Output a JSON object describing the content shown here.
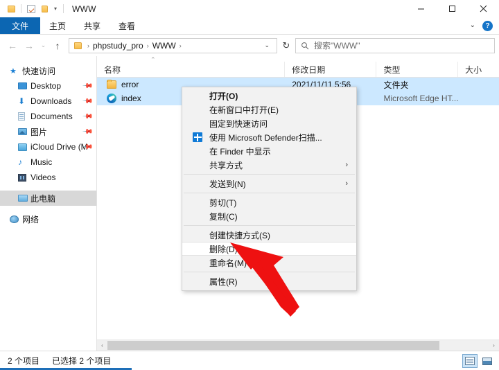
{
  "window": {
    "title": "WWW",
    "quick_access_icons": [
      "folder-icon",
      "properties-icon",
      "new-folder-icon"
    ],
    "controls": {
      "minimize": "minimize-icon",
      "maximize": "maximize-icon",
      "close": "close-icon"
    }
  },
  "ribbon": {
    "tabs": [
      {
        "label": "文件",
        "active": true
      },
      {
        "label": "主页",
        "active": false
      },
      {
        "label": "共享",
        "active": false
      },
      {
        "label": "查看",
        "active": false
      }
    ],
    "expand_label": "⌄",
    "help_label": "?"
  },
  "address": {
    "back": "←",
    "forward": "→",
    "recent": "⌄",
    "up": "↑",
    "crumbs": [
      "phpstudy_pro",
      "WWW"
    ],
    "separator": "›",
    "dropdown": "⌄",
    "refresh": "↻"
  },
  "search": {
    "placeholder": "搜索\"WWW\"",
    "icon": "search-icon"
  },
  "sidebar": {
    "items": [
      {
        "label": "快速访问",
        "icon": "star-icon",
        "pinned": false,
        "indent": false,
        "selected": false
      },
      {
        "label": "Desktop",
        "icon": "desktop-icon",
        "pinned": true,
        "indent": true,
        "selected": false
      },
      {
        "label": "Downloads",
        "icon": "download-icon",
        "pinned": true,
        "indent": true,
        "selected": false
      },
      {
        "label": "Documents",
        "icon": "document-icon",
        "pinned": true,
        "indent": true,
        "selected": false
      },
      {
        "label": "图片",
        "icon": "pictures-icon",
        "pinned": true,
        "indent": true,
        "selected": false
      },
      {
        "label": "iCloud Drive (M",
        "icon": "cloud-drive-icon",
        "pinned": true,
        "indent": true,
        "selected": false
      },
      {
        "label": "Music",
        "icon": "music-icon",
        "pinned": false,
        "indent": true,
        "selected": false
      },
      {
        "label": "Videos",
        "icon": "video-icon",
        "pinned": false,
        "indent": true,
        "selected": false
      },
      {
        "label": "此电脑",
        "icon": "this-pc-icon",
        "pinned": false,
        "indent": true,
        "selected": true
      },
      {
        "label": "网络",
        "icon": "network-icon",
        "pinned": false,
        "indent": false,
        "selected": false
      }
    ],
    "pin_glyph": "📌"
  },
  "filelist": {
    "sort_caret": "⌃",
    "columns": [
      {
        "key": "name",
        "label": "名称"
      },
      {
        "key": "date",
        "label": "修改日期"
      },
      {
        "key": "type",
        "label": "类型"
      },
      {
        "key": "size",
        "label": "大小"
      }
    ],
    "rows": [
      {
        "name": "error",
        "date": "2021/11/11 5:56",
        "type": "文件夹",
        "size": "",
        "icon": "folder-icon",
        "selected": true
      },
      {
        "name": "index",
        "date": "",
        "type": "Microsoft Edge HT...",
        "size": "",
        "icon": "edge-icon",
        "selected": true
      }
    ]
  },
  "context_menu": {
    "items": [
      {
        "label": "打开(O)",
        "bold": true,
        "icon": null,
        "submenu": false,
        "hover": false,
        "separator_after": false
      },
      {
        "label": "在新窗口中打开(E)",
        "bold": false,
        "icon": null,
        "submenu": false,
        "hover": false,
        "separator_after": false
      },
      {
        "label": "固定到快速访问",
        "bold": false,
        "icon": null,
        "submenu": false,
        "hover": false,
        "separator_after": false
      },
      {
        "label": "使用 Microsoft Defender扫描...",
        "bold": false,
        "icon": "defender-icon",
        "submenu": false,
        "hover": false,
        "separator_after": false
      },
      {
        "label": "在 Finder 中显示",
        "bold": false,
        "icon": null,
        "submenu": false,
        "hover": false,
        "separator_after": false
      },
      {
        "label": "共享方式",
        "bold": false,
        "icon": null,
        "submenu": true,
        "hover": false,
        "separator_after": true
      },
      {
        "label": "发送到(N)",
        "bold": false,
        "icon": null,
        "submenu": true,
        "hover": false,
        "separator_after": true
      },
      {
        "label": "剪切(T)",
        "bold": false,
        "icon": null,
        "submenu": false,
        "hover": false,
        "separator_after": false
      },
      {
        "label": "复制(C)",
        "bold": false,
        "icon": null,
        "submenu": false,
        "hover": false,
        "separator_after": true
      },
      {
        "label": "创建快捷方式(S)",
        "bold": false,
        "icon": null,
        "submenu": false,
        "hover": false,
        "separator_after": false
      },
      {
        "label": "删除(D)",
        "bold": false,
        "icon": null,
        "submenu": false,
        "hover": true,
        "separator_after": false
      },
      {
        "label": "重命名(M)",
        "bold": false,
        "icon": null,
        "submenu": false,
        "hover": false,
        "separator_after": true
      },
      {
        "label": "属性(R)",
        "bold": false,
        "icon": null,
        "submenu": false,
        "hover": false,
        "separator_after": false
      }
    ],
    "submenu_glyph": "›"
  },
  "annotation": {
    "arrow_color": "#ee1111",
    "points_to": "删除(D)"
  },
  "scrollbar": {
    "left_arrow": "‹",
    "right_arrow": "›"
  },
  "statusbar": {
    "item_count": "2 个项目",
    "selection": "已选择 2 个项目",
    "views": [
      {
        "name": "details-view",
        "active": true
      },
      {
        "name": "large-icons-view",
        "active": false
      }
    ]
  }
}
